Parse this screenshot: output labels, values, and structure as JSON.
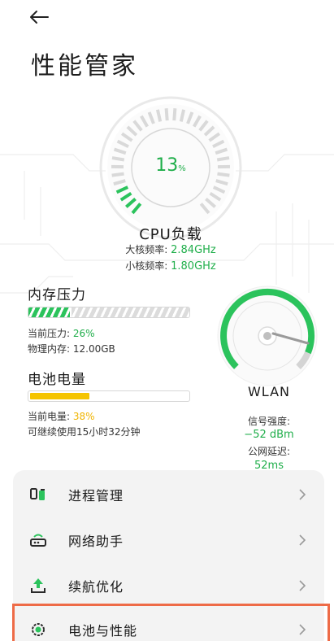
{
  "header": {
    "title": "性能管家"
  },
  "cpu": {
    "load_value": "13",
    "load_unit": "%",
    "label": "CPU负载",
    "big_core_label": "大核频率:",
    "big_core_value": "2.84GHz",
    "small_core_label": "小核频率:",
    "small_core_value": "1.80GHz"
  },
  "memory": {
    "title": "内存压力",
    "pressure_label": "当前压力:",
    "pressure_value": "26%",
    "pressure_level": 0.26,
    "physical_label": "物理内存:",
    "physical_value": "12.00GB"
  },
  "battery": {
    "title": "电池电量",
    "level_label": "当前电量:",
    "level_value": "38%",
    "level": 0.38,
    "remaining_text": "可继续使用15小时32分钟"
  },
  "wlan": {
    "label": "WLAN",
    "signal_label": "信号强度:",
    "signal_value": "−52 dBm",
    "latency_label": "公网延迟:",
    "latency_value": "52ms"
  },
  "menu": {
    "items": [
      {
        "label": "进程管理",
        "icon": "process-icon"
      },
      {
        "label": "网络助手",
        "icon": "router-icon"
      },
      {
        "label": "续航优化",
        "icon": "battery-optimize-icon"
      },
      {
        "label": "电池与性能",
        "icon": "gear-icon"
      }
    ]
  },
  "colors": {
    "accent_green": "#1fae4a",
    "battery_yellow": "#f5c400",
    "highlight_orange": "#ee6b47"
  }
}
